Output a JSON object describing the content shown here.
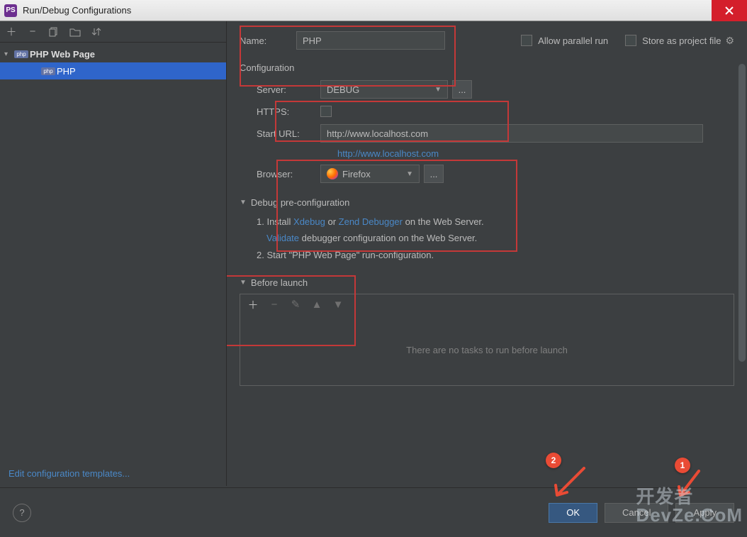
{
  "titlebar": {
    "title": "Run/Debug Configurations"
  },
  "tree": {
    "root_label": "PHP Web Page",
    "child_label": "PHP"
  },
  "edit_templates": "Edit configuration templates...",
  "form": {
    "name_label": "Name:",
    "name_value": "PHP",
    "allow_parallel": "Allow parallel run",
    "store_project": "Store as project file",
    "config_section": "Configuration",
    "server_label": "Server:",
    "server_value": "DEBUG",
    "https_label": "HTTPS:",
    "starturl_label": "Start URL:",
    "starturl_value": "http://www.localhost.com",
    "starturl_link": "http://www.localhost.com",
    "browser_label": "Browser:",
    "browser_value": "Firefox",
    "dots": "..."
  },
  "debug": {
    "section": "Debug pre-configuration",
    "step1_prefix": "1. Install ",
    "step1_link1": "Xdebug",
    "step1_mid": " or ",
    "step1_link2": "Zend Debugger",
    "step1_suffix": " on the Web Server.",
    "validate_link": "Validate",
    "validate_suffix": " debugger configuration on the Web Server.",
    "step2": "2. Start \"PHP Web Page\" run-configuration."
  },
  "before_launch": {
    "section": "Before launch",
    "empty": "There are no tasks to run before launch"
  },
  "buttons": {
    "ok": "OK",
    "cancel": "Cancel",
    "apply": "Apply",
    "help": "?"
  },
  "callouts": {
    "c1": "1",
    "c2": "2"
  },
  "watermark": {
    "line1": "开发者",
    "line2": "DevZe.CoM"
  }
}
